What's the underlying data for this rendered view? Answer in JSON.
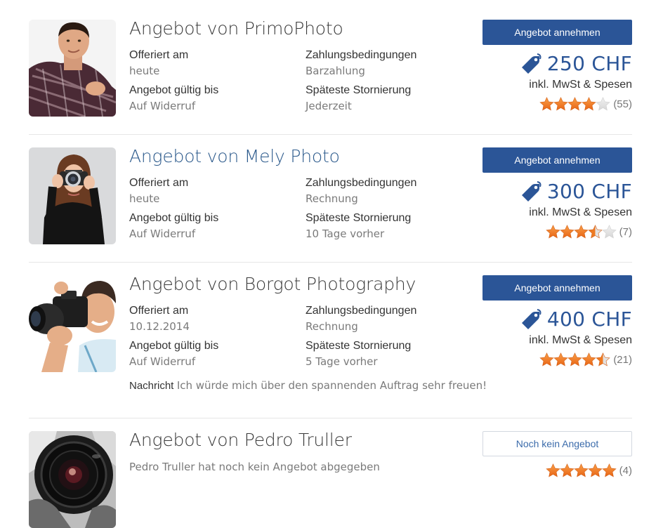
{
  "labels": {
    "offered_on": "Offeriert am",
    "payment_terms": "Zahlungsbedingungen",
    "valid_until": "Angebot gültig bis",
    "latest_cancellation": "Späteste Stornierung",
    "accept_button": "Angebot annehmen",
    "incl": "inkl. MwSt & Spesen",
    "message": "Nachricht"
  },
  "colors": {
    "accent": "#2b5597",
    "star_on": "#f07a1e",
    "star_off": "#dddddd"
  },
  "offers": [
    {
      "title": "Angebot von PrimoPhoto",
      "offered_on": "heute",
      "payment_terms": "Barzahlung",
      "valid_until": "Auf Widerruf",
      "latest_cancellation": "Jederzeit",
      "price": "250 CHF",
      "rating": 4,
      "reviews": "(55)",
      "avatar_icon": "man-portrait-photo"
    },
    {
      "title": "Angebot von Mely Photo",
      "offered_on": "heute",
      "payment_terms": "Rechnung",
      "valid_until": "Auf Widerruf",
      "latest_cancellation": "10 Tage vorher",
      "price": "300 CHF",
      "rating": 3.5,
      "reviews": "(7)",
      "avatar_icon": "woman-with-camera-photo"
    },
    {
      "title": "Angebot von Borgot Photography",
      "offered_on": "10.12.2014",
      "payment_terms": "Rechnung",
      "valid_until": "Auf Widerruf",
      "latest_cancellation": "5 Tage vorher",
      "price": "400 CHF",
      "rating": 4.5,
      "reviews": "(21)",
      "message": "Ich würde mich über den spannenden Auftrag sehr freuen!",
      "avatar_icon": "photographer-with-camera-photo"
    },
    {
      "title": "Angebot von Pedro Truller",
      "note": "Pedro Truller hat noch kein Angebot abgegeben",
      "no_offer_button": "Noch kein Angebot",
      "rating": 5,
      "reviews": "(4)",
      "avatar_icon": "camera-lens-photo"
    }
  ]
}
